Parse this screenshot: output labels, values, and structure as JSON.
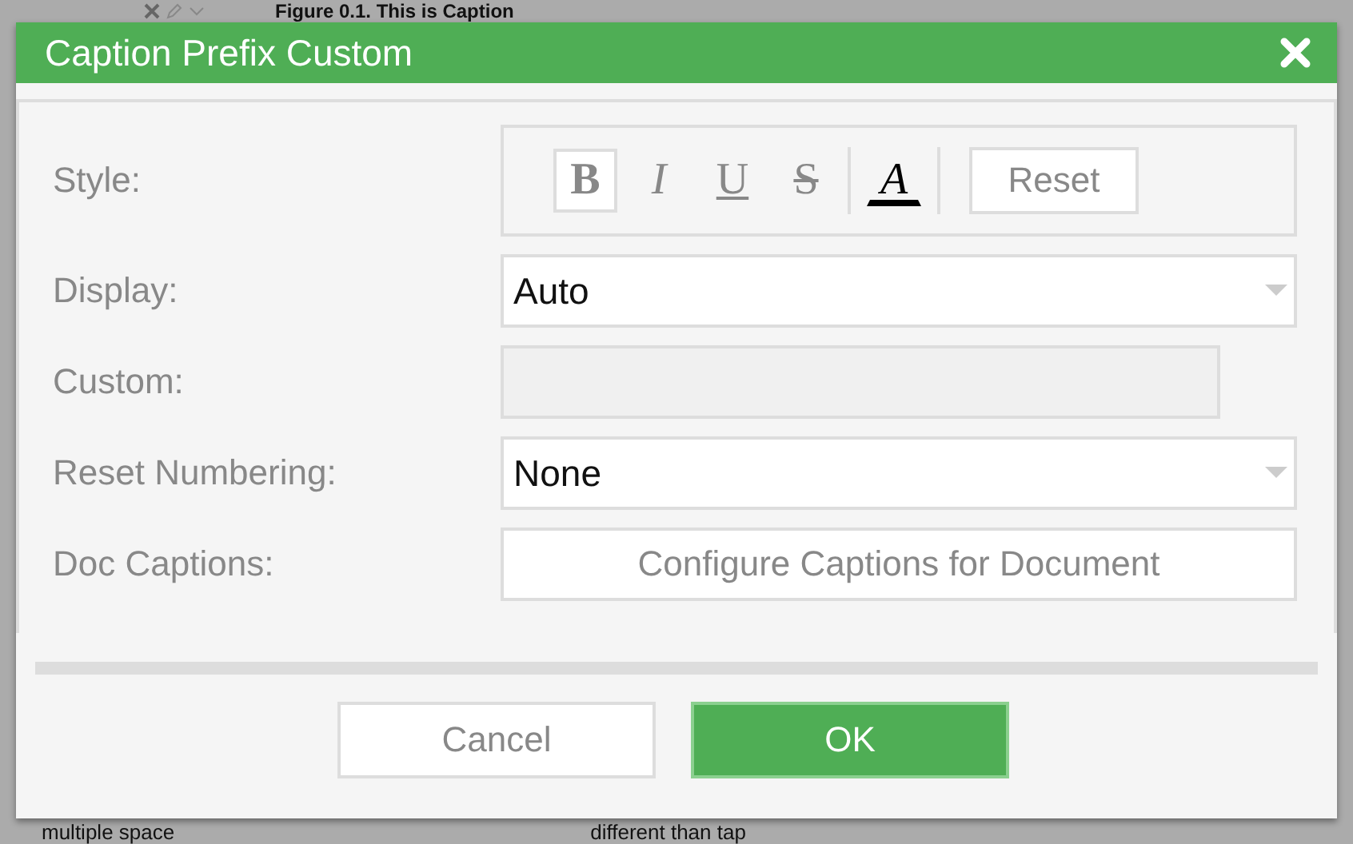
{
  "background": {
    "caption": "Figure 0.1. This is Caption",
    "lines": [
      "multiple space",
      "different than tap"
    ]
  },
  "dialog": {
    "title": "Caption Prefix Custom",
    "fields": [
      {
        "kind": "style",
        "label": "Style:",
        "format_buttons": [
          {
            "glyph": "B",
            "kind": "bold",
            "selected": true
          },
          {
            "glyph": "I",
            "kind": "italic",
            "selected": false
          },
          {
            "glyph": "U",
            "kind": "underline",
            "selected": false
          },
          {
            "glyph": "S",
            "kind": "strike",
            "selected": false
          }
        ],
        "color_glyph": "A",
        "reset": "Reset"
      },
      {
        "kind": "select",
        "label": "Display:",
        "value": "Auto"
      },
      {
        "kind": "text",
        "label": "Custom:",
        "disabled": true
      },
      {
        "kind": "select",
        "label": "Reset Numbering:",
        "value": "None"
      },
      {
        "kind": "action",
        "label": "Doc Captions:",
        "button": "Configure Captions for Document"
      }
    ],
    "buttons": [
      {
        "label": "Cancel",
        "primary": false
      },
      {
        "label": "OK",
        "primary": true
      }
    ]
  }
}
